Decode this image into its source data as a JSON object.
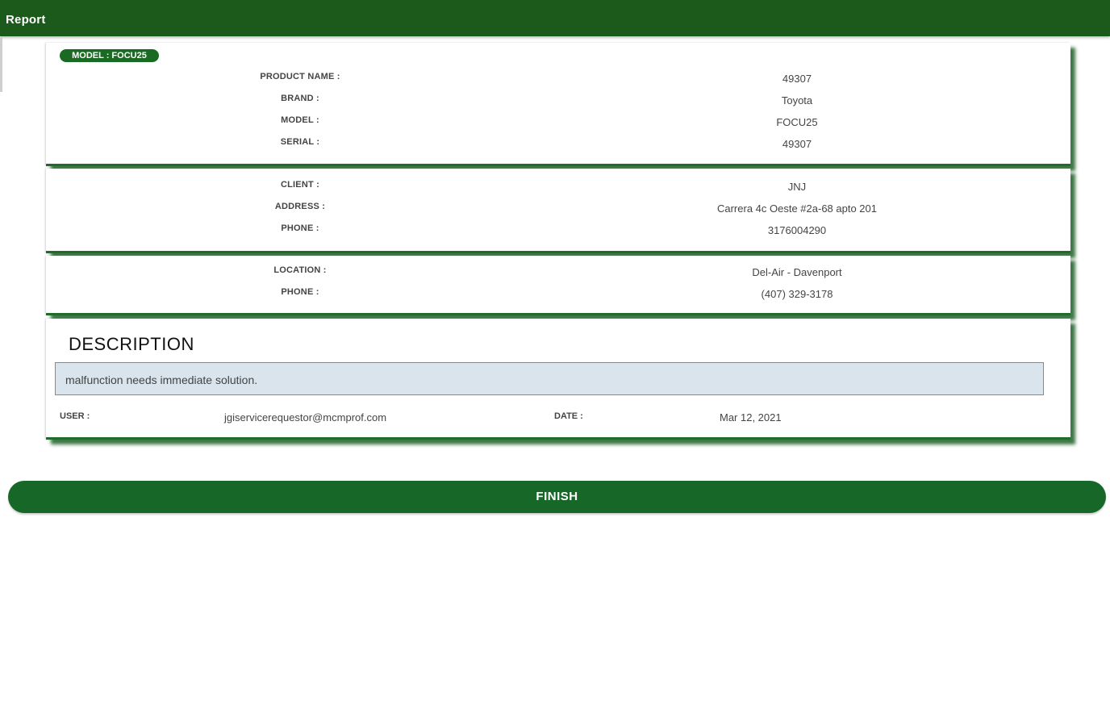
{
  "header": {
    "title": "Report"
  },
  "product": {
    "badge": "MODEL : FOCU25",
    "fields": [
      {
        "label": "PRODUCT NAME :",
        "value": "49307"
      },
      {
        "label": "BRAND :",
        "value": "Toyota"
      },
      {
        "label": "MODEL :",
        "value": "FOCU25"
      },
      {
        "label": "SERIAL :",
        "value": "49307"
      }
    ]
  },
  "client": {
    "fields": [
      {
        "label": "CLIENT :",
        "value": "JNJ"
      },
      {
        "label": "ADDRESS :",
        "value": "Carrera 4c Oeste #2a-68 apto 201"
      },
      {
        "label": "PHONE :",
        "value": "3176004290"
      }
    ]
  },
  "location": {
    "fields": [
      {
        "label": "LOCATION :",
        "value": "Del-Air - Davenport"
      },
      {
        "label": "PHONE :",
        "value": "(407) 329-3178"
      }
    ]
  },
  "description": {
    "title": "DESCRIPTION",
    "text": "malfunction needs immediate solution.",
    "user_label": "USER :",
    "user_value": "jgiservicerequestor@mcmprof.com",
    "date_label": "DATE :",
    "date_value": "Mar 12, 2021"
  },
  "actions": {
    "finish_label": "FINISH"
  },
  "colors": {
    "header_green": "#1b5a1b",
    "accent_green": "#176828",
    "description_bg": "#d9e4ec"
  }
}
